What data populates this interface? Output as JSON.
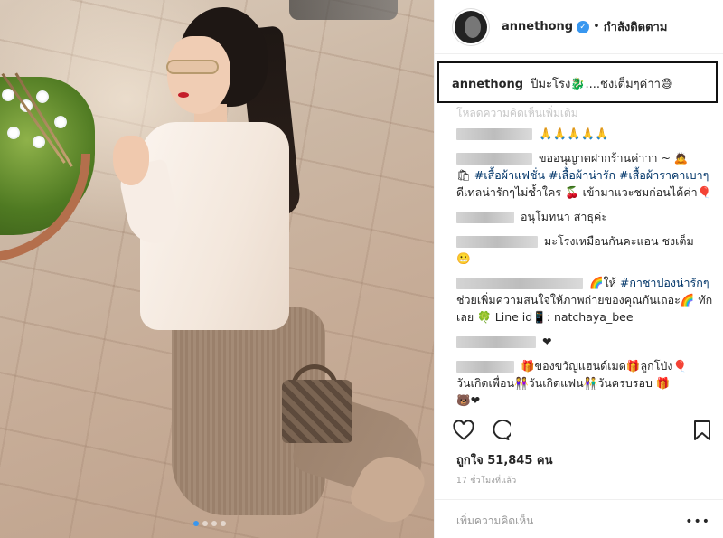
{
  "header": {
    "username": "annethong",
    "separator": "•",
    "follow_label": "กำลังติดตาม"
  },
  "caption": {
    "username": "annethong",
    "text": "ปีมะโรง🐉....ชงเต็มๆค่าา😅"
  },
  "load_more_label": "โหลดความคิดเห็นเพิ่มเติม",
  "comments": [
    {
      "text": "🙏🙏🙏🙏🙏"
    },
    {
      "text": "ขออนุญาตฝากร้านค่าาา ~ 🙇",
      "line2_tags": "#เสื้อผ้าแฟชั่น #เสื้อผ้าน่ารัก #เสื้อผ้าราคาเบาๆ",
      "line2_rest": " ดีเทลน่ารักๆไม่ซ้ำใคร 🍒 เข้ามาแวะชมก่อนได้ค่า🎈",
      "emoji_prefix": "🛍"
    },
    {
      "text": "อนุโมทนา สาธุค่ะ"
    },
    {
      "text": "มะโรงเหมือนกันคะแอน ชงเต็ม",
      "line2": "😬"
    },
    {
      "text": "🌈ให้ ",
      "tag": "#กาชาปองน่ารักๆ",
      "rest": " ช่วยเพิ่มความสนใจให้ภาพถ่ายของคุณกันเถอะ🌈 ทักเลย 🍀 Line id📱: natchaya_bee"
    },
    {
      "text": "❤"
    },
    {
      "text": "🎁ของขวัญแฮนด์เมด🎁ลูกโป่ง🎈",
      "line2": "วันเกิดเพื่อน👭วันเกิดแฟน👫วันครบรอบ 🎁",
      "line3": "🐻❤"
    }
  ],
  "icons": {
    "like": "heart-icon",
    "comment": "comment-bubble-icon",
    "save": "bookmark-icon",
    "more": "more-options-icon",
    "verified": "verified-badge-icon"
  },
  "likes_label": "ถูกใจ 51,845 คน",
  "time_label": "17 ชั่วโมงที่แล้ว",
  "add_comment_placeholder": "เพิ่มความคิดเห็น",
  "more_symbol": "•••",
  "verified_symbol": "✓",
  "carousel": {
    "total": 4,
    "active": 1
  }
}
